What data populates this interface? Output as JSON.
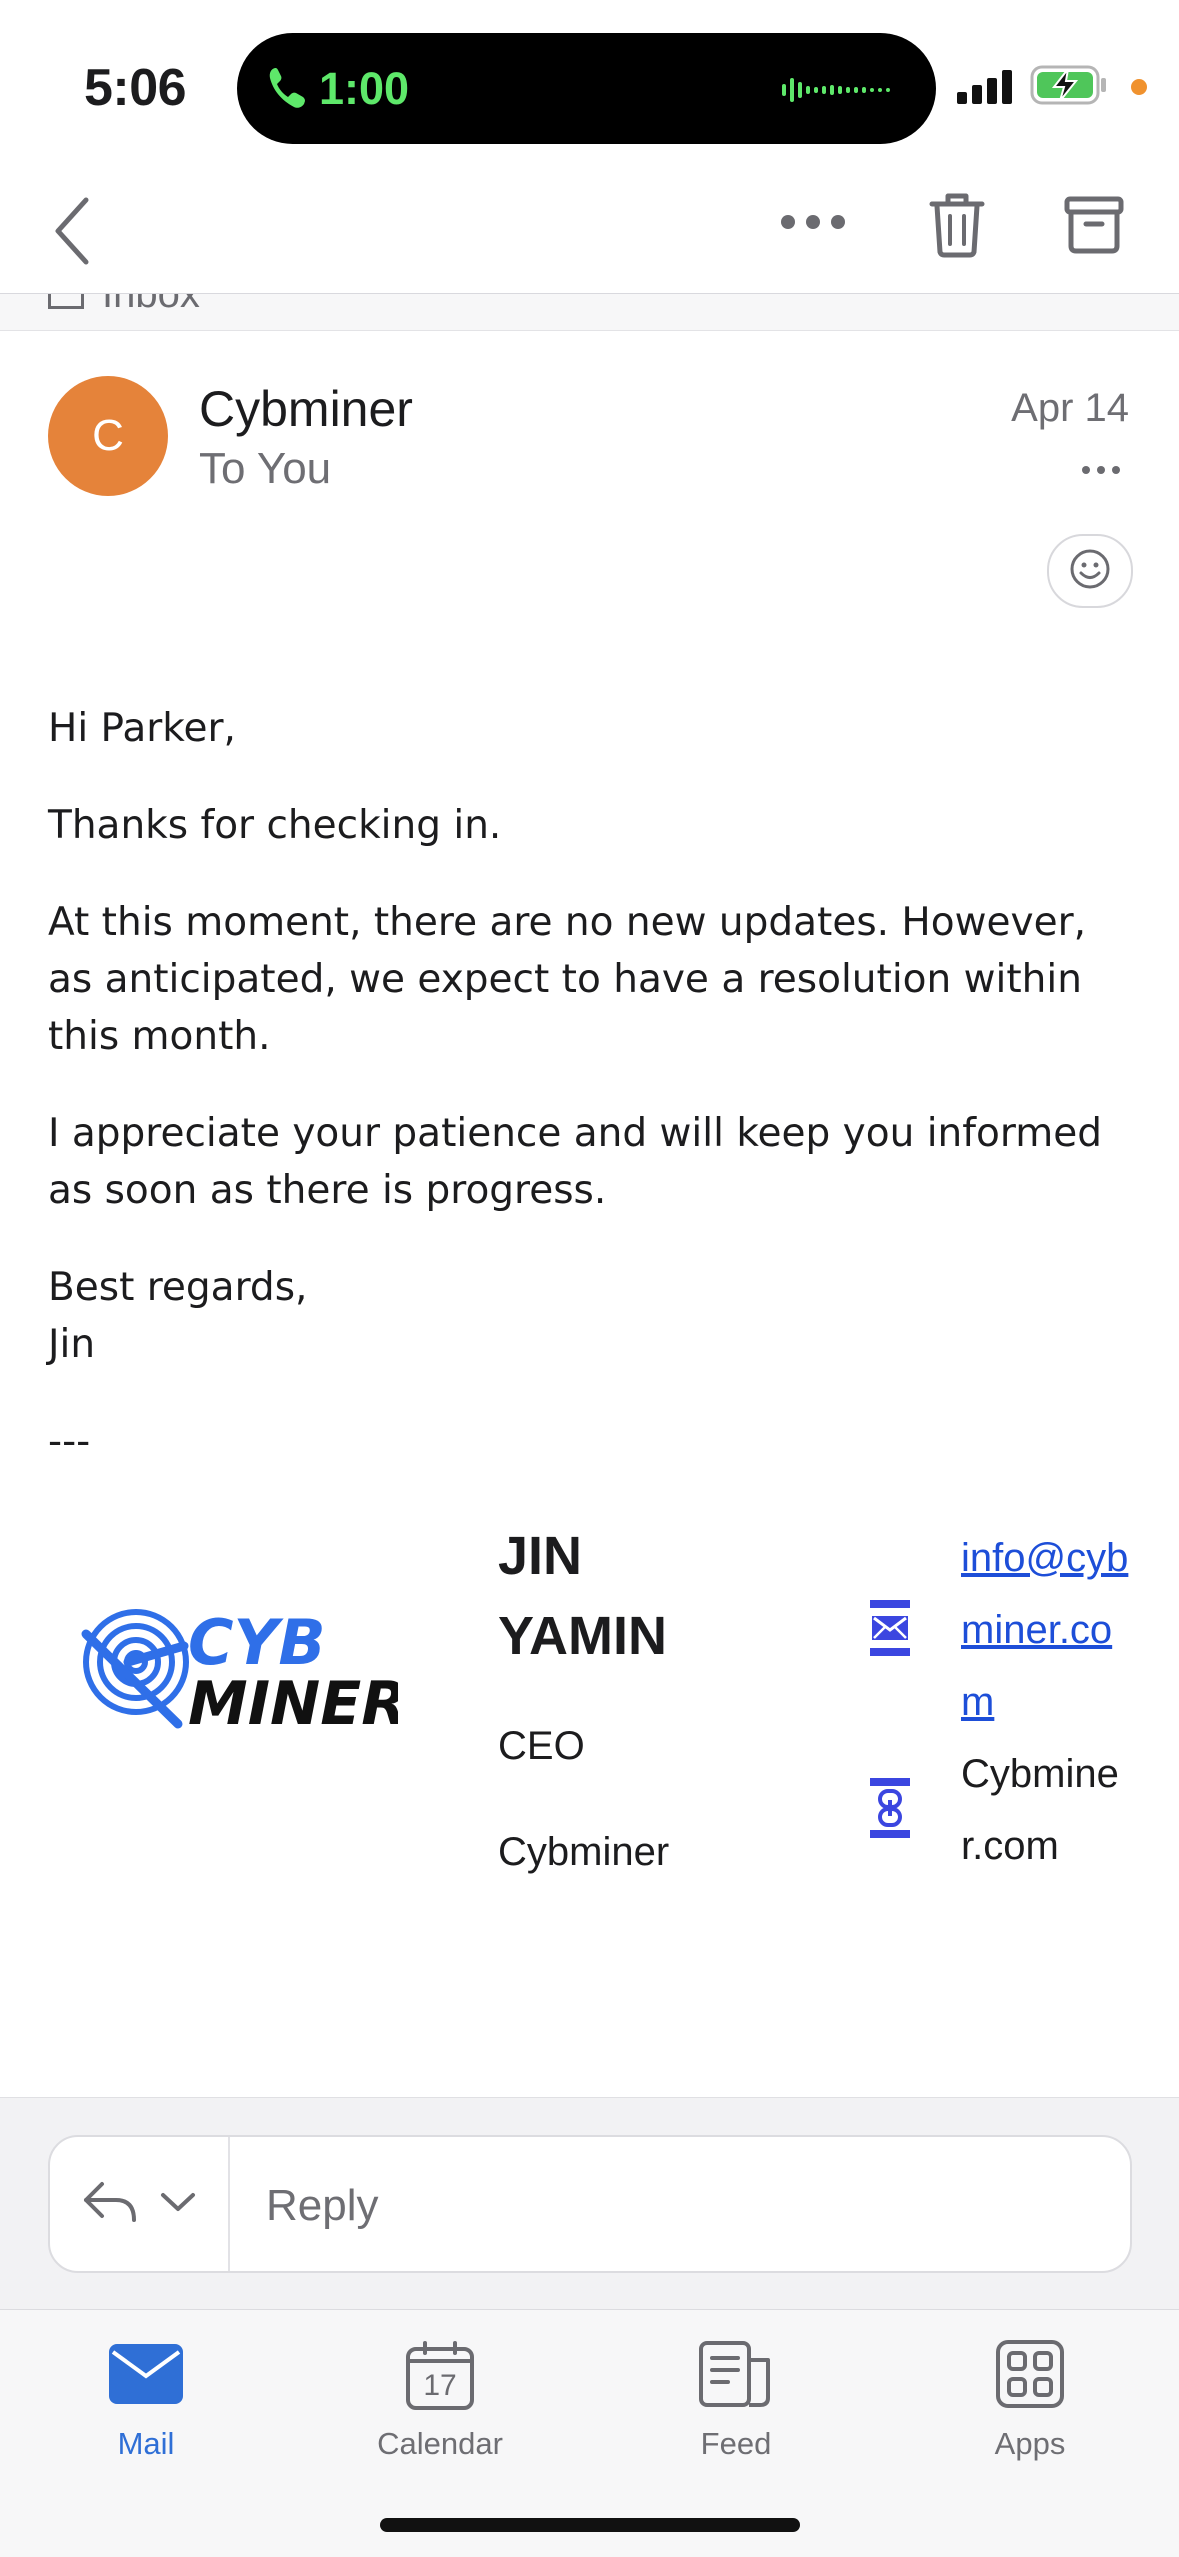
{
  "status_bar": {
    "time": "5:06",
    "call_timer": "1:00",
    "accent_call_color": "#5ee86a",
    "battery_state": "charging"
  },
  "nav": {
    "back_icon": "chevron-left-icon",
    "more_icon": "ellipsis-icon",
    "delete_icon": "trash-icon",
    "archive_icon": "archive-box-icon",
    "folder_label": "Inbox"
  },
  "message": {
    "avatar_initial": "C",
    "avatar_color": "#e5833a",
    "sender": "Cybminer",
    "recipient": "To You",
    "date": "Apr 14",
    "body": {
      "greeting": "Hi Parker,",
      "p1": "Thanks for checking in.",
      "p2": "At this moment, there are no new updates. However, as anticipated, we expect to have a resolution within this month.",
      "p3": "I appreciate your patience and will keep you informed as soon as there is progress.",
      "closing": "Best regards,",
      "signoff": "Jin",
      "separator": "---"
    }
  },
  "signature": {
    "logo_line1": "CYB",
    "logo_line2": "MINER",
    "name": "JIN YAMIN",
    "title": "CEO",
    "company": "Cybminer",
    "email": "info@cybminer.com",
    "website": "Cybminer.com",
    "brand_color": "#2f6fe8"
  },
  "reply": {
    "placeholder": "Reply"
  },
  "tabbar": {
    "tabs": [
      {
        "label": "Mail",
        "icon": "mail-icon",
        "active": true
      },
      {
        "label": "Calendar",
        "icon": "calendar-icon",
        "day": "17",
        "active": false
      },
      {
        "label": "Feed",
        "icon": "feed-icon",
        "active": false
      },
      {
        "label": "Apps",
        "icon": "apps-grid-icon",
        "active": false
      }
    ]
  }
}
